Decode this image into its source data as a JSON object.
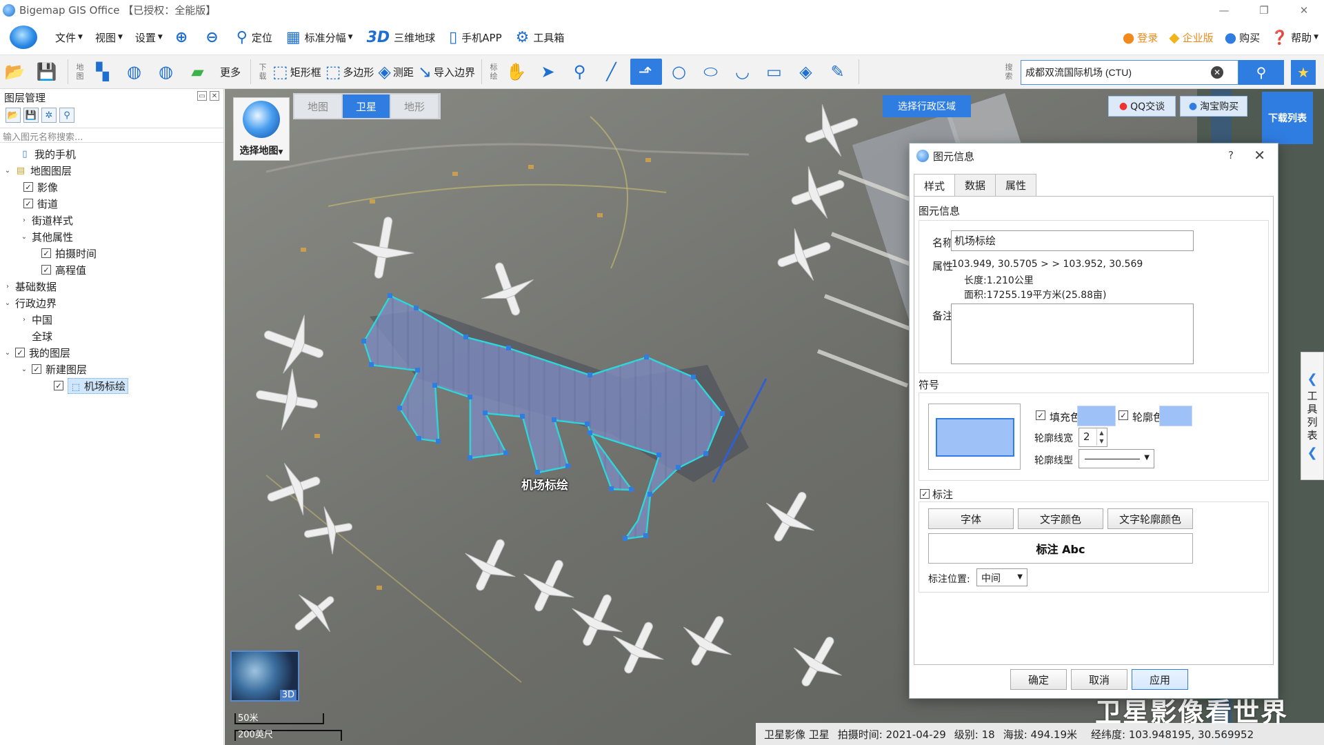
{
  "window": {
    "title": "Bigemap GIS Office 【已授权：全能版】"
  },
  "menubar": {
    "menus": [
      "文件",
      "视图",
      "设置"
    ],
    "tools": [
      "定位",
      "标准分幅",
      "三维地球",
      "手机APP",
      "工具箱"
    ],
    "tool_icons": {
      "3d": "3D"
    },
    "right": [
      "登录",
      "企业版",
      "购买",
      "帮助"
    ]
  },
  "toolbar": {
    "group1_label": "地图",
    "more": "更多",
    "group2_label": "下载",
    "rect": "矩形框",
    "polygon": "多边形",
    "measure": "测距",
    "import_border": "导入边界",
    "group3_label": "标绘",
    "group4_label": "搜索",
    "search_value": "成都双流国际机场 (CTU)"
  },
  "leftpanel": {
    "title": "图层管理",
    "search_placeholder": "输入图元名称搜索...",
    "tree": {
      "my_phone": "我的手机",
      "map_layers": "地图图层",
      "imagery": "影像",
      "streets": "街道",
      "street_style": "街道样式",
      "other_attrs": "其他属性",
      "capture_time": "拍摄时间",
      "elevation": "高程值",
      "basic_data": "基础数据",
      "admin_border": "行政边界",
      "china": "中国",
      "global": "全球",
      "my_layers": "我的图层",
      "new_layer": "新建图层",
      "airport": "机场标绘"
    }
  },
  "map": {
    "select_map": "选择地图",
    "tabs": [
      "地图",
      "卫星",
      "地形"
    ],
    "active_tab": "卫星",
    "select_region": "选择行政区域",
    "qq": "QQ交谈",
    "taobao": "淘宝购买",
    "download_list": "下载列表",
    "side_toolbox": [
      "工",
      "具",
      "列",
      "表"
    ],
    "minimap_3d": "3D",
    "scale_metric": "50米",
    "scale_imperial": "200英尺",
    "feature_label": "机场标绘",
    "watermark": "卫星影像看世界"
  },
  "status": {
    "source": "卫星影像 卫星",
    "capture": "拍摄时间: 2021-04-29",
    "level": "级别: 18",
    "altitude": "海拔: 494.19米",
    "coords": "经纬度: 103.948195, 30.569952"
  },
  "dialog": {
    "title": "图元信息",
    "help": "?",
    "tabs": [
      "样式",
      "数据",
      "属性"
    ],
    "section_info": "图元信息",
    "name_label": "名称",
    "name_value": "机场标绘",
    "attr_label": "属性",
    "attr_line1": "103.949, 30.5705 > > 103.952, 30.569",
    "attr_line2": "长度:1.210公里",
    "attr_line3": "面积:17255.19平方米(25.88亩)",
    "note_label": "备注",
    "section_symbol": "符号",
    "fill_color": "填充色",
    "outline_color": "轮廓色",
    "outline_width_label": "轮廓线宽",
    "outline_width_value": "2",
    "outline_type_label": "轮廓线型",
    "label_section": "标注",
    "font_btn": "字体",
    "text_color_btn": "文字颜色",
    "text_outline_btn": "文字轮廓颜色",
    "preview_text": "标注 Abc",
    "label_pos_label": "标注位置:",
    "label_pos_value": "中间",
    "ok": "确定",
    "cancel": "取消",
    "apply": "应用",
    "fill_hex": "#9ec1f7",
    "accent_hex": "#2f7de1"
  }
}
